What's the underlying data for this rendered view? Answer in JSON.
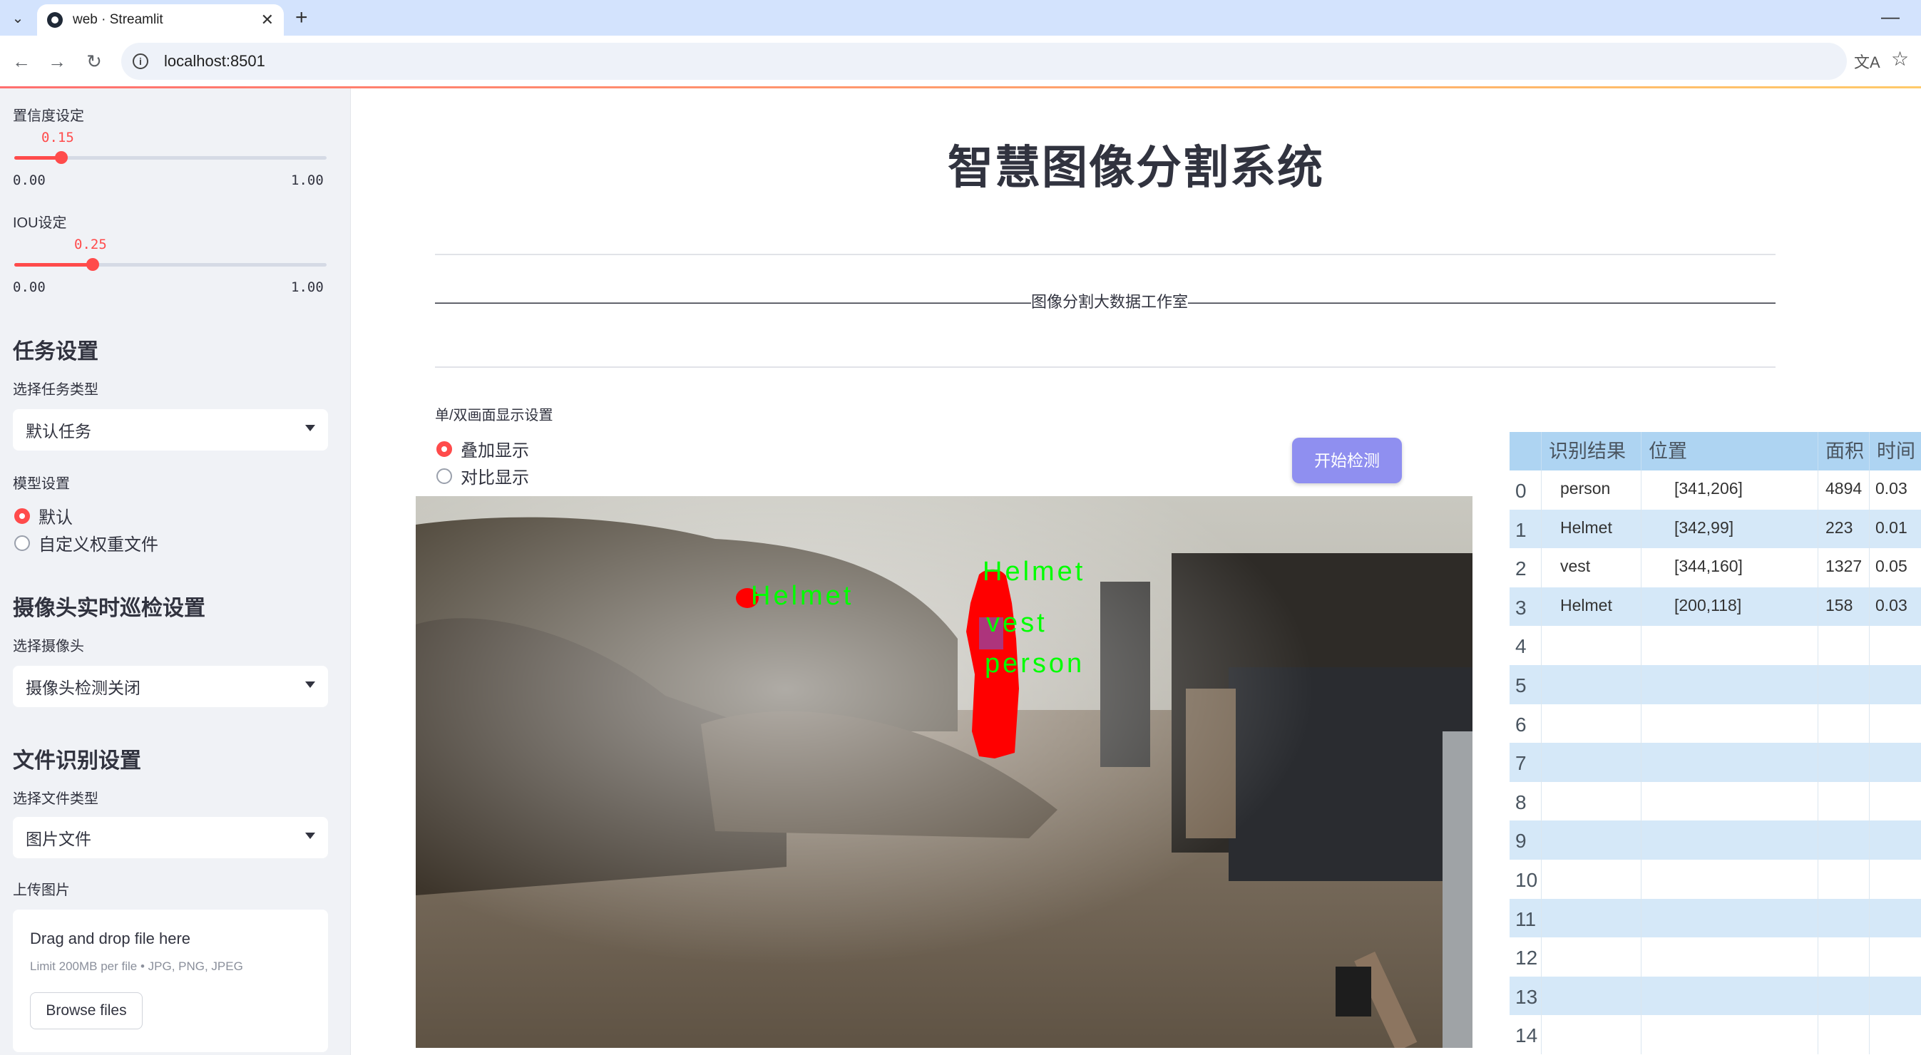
{
  "browser": {
    "tab_title": "web · Streamlit",
    "url": "localhost:8501"
  },
  "sidebar": {
    "confidence": {
      "label": "置信度设定",
      "value": "0.15",
      "value_fraction": 0.15,
      "min": "0.00",
      "max": "1.00"
    },
    "iou": {
      "label": "IOU设定",
      "value": "0.25",
      "value_fraction": 0.25,
      "min": "0.00",
      "max": "1.00"
    },
    "task_header": "任务设置",
    "task_type_label": "选择任务类型",
    "task_type_value": "默认任务",
    "model_label": "模型设置",
    "model_options": [
      "默认",
      "自定义权重文件"
    ],
    "model_selected": "默认",
    "camera_header": "摄像头实时巡检设置",
    "camera_label": "选择摄像头",
    "camera_value": "摄像头检测关闭",
    "file_header": "文件识别设置",
    "file_type_label": "选择文件类型",
    "file_type_value": "图片文件",
    "upload_label": "上传图片",
    "upload_title": "Drag and drop file here",
    "upload_sub": "Limit 200MB per file • JPG, PNG, JPEG",
    "browse_label": "Browse files"
  },
  "main": {
    "title": "智慧图像分割系统",
    "subtitle": "——————————————————————————————————————图像分割大数据工作室——————————————————————————————————————",
    "display_label": "单/双画面显示设置",
    "display_options": [
      "叠加显示",
      "对比显示"
    ],
    "display_selected": "叠加显示",
    "start_button": "开始检测",
    "detections_overlay": [
      "Helmet",
      "Helmet",
      "vest",
      "person"
    ]
  },
  "table": {
    "headers": [
      "",
      "识别结果",
      "位置",
      "面积",
      "时间"
    ],
    "rows": [
      [
        "0",
        "person",
        "[341,206]",
        "4894",
        "0.03"
      ],
      [
        "1",
        "Helmet",
        "[342,99]",
        "223",
        "0.01"
      ],
      [
        "2",
        "vest",
        "[344,160]",
        "1327",
        "0.05"
      ],
      [
        "3",
        "Helmet",
        "[200,118]",
        "158",
        "0.03"
      ],
      [
        "4",
        "",
        "",
        "",
        ""
      ],
      [
        "5",
        "",
        "",
        "",
        ""
      ],
      [
        "6",
        "",
        "",
        "",
        ""
      ],
      [
        "7",
        "",
        "",
        "",
        ""
      ],
      [
        "8",
        "",
        "",
        "",
        ""
      ],
      [
        "9",
        "",
        "",
        "",
        ""
      ],
      [
        "10",
        "",
        "",
        "",
        ""
      ],
      [
        "11",
        "",
        "",
        "",
        ""
      ],
      [
        "12",
        "",
        "",
        "",
        ""
      ],
      [
        "13",
        "",
        "",
        "",
        ""
      ],
      [
        "14",
        "",
        "",
        "",
        ""
      ]
    ]
  },
  "colors": {
    "accent": "#ff4b4b",
    "button": "#8f8ff0",
    "table_header": "#aed4f2",
    "table_alt": "#d5e8f8",
    "overlay_text": "#00ff00",
    "mask": "#ff0000"
  }
}
